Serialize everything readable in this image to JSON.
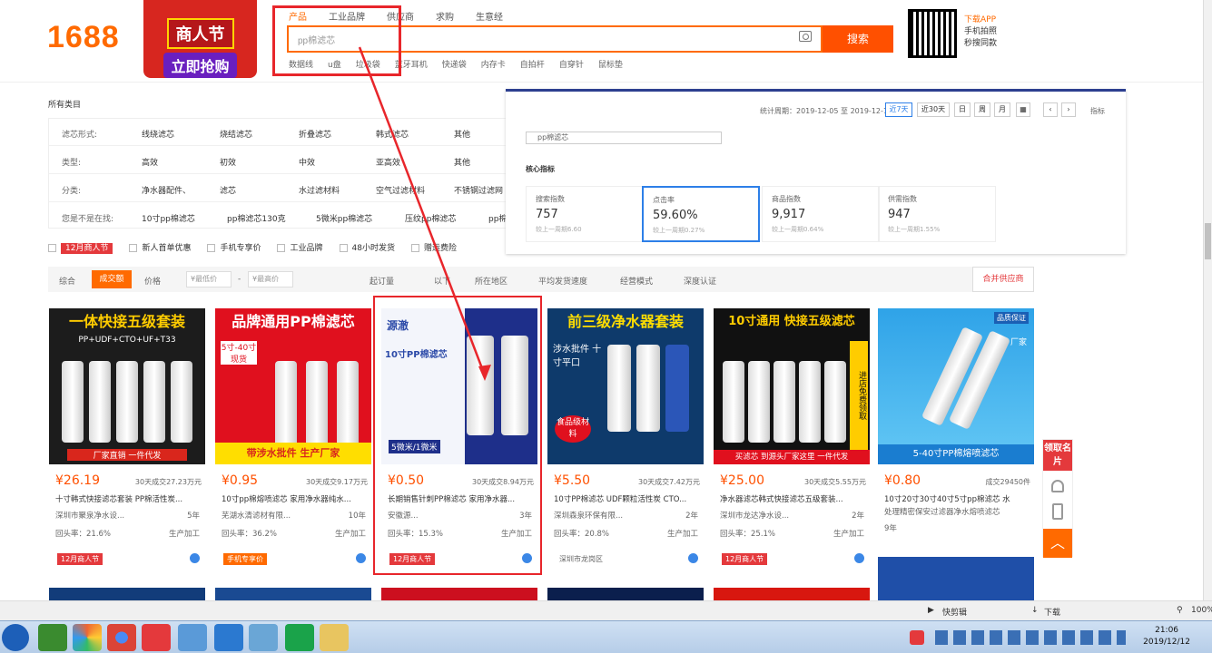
{
  "header": {
    "logo": "1688",
    "promo_line1": "商人节",
    "promo_line2": "立即抢购",
    "search_tabs": [
      "产品",
      "工业品牌",
      "供应商",
      "求购",
      "生意经"
    ],
    "search_value": "pp棉滤芯",
    "search_button": "搜索",
    "hot_words": [
      "数据线",
      "u盘",
      "垃圾袋",
      "蓝牙耳机",
      "快递袋",
      "内存卡",
      "自拍杆",
      "自穿针",
      "鼠标垫"
    ],
    "app_line1": "下载APP",
    "app_line2": "手机拍照",
    "app_line3": "秒搜同款"
  },
  "category": {
    "title": "所有类目",
    "rows": [
      {
        "label": "滤芯形式:",
        "items": [
          "线绕滤芯",
          "烧结滤芯",
          "折叠滤芯",
          "韩式滤芯",
          "其他"
        ]
      },
      {
        "label": "类型:",
        "items": [
          "高效",
          "初效",
          "中效",
          "亚高效",
          "其他"
        ]
      },
      {
        "label": "分类:",
        "items": [
          "净水器配件、",
          "滤芯",
          "水过滤材料",
          "空气过滤材料",
          "不锈钢过滤网"
        ]
      },
      {
        "label": "您是不是在找:",
        "items": [
          "10寸pp棉滤芯",
          "pp棉滤芯130克",
          "5微米pp棉滤芯",
          "压纹pp棉滤芯",
          "pp棉"
        ]
      }
    ]
  },
  "checks": {
    "badge": "12月商人节",
    "items": [
      "新人首单优惠",
      "手机专享价",
      "工业品牌",
      "48小时发货",
      "赠运费险"
    ]
  },
  "sortbar": {
    "items": [
      "综合",
      "成交额",
      "价格",
      "¥最低价",
      "¥最高价",
      "起订量",
      "以下",
      "所在地区",
      "平均发货速度",
      "经营模式",
      "深度认证"
    ],
    "dash": "-",
    "supplier": "合并供应商"
  },
  "stats_popup": {
    "period": "统计周期：2019-12-05 至 2019-12-11",
    "ranges": [
      "近7天",
      "近30天",
      "日",
      "周",
      "月"
    ],
    "more": "指标",
    "keyword": "pp棉滤芯",
    "core_title": "核心指标",
    "metrics": [
      {
        "label": "搜索指数",
        "value": "757",
        "sub": "较上一周期6.60"
      },
      {
        "label": "点击率",
        "value": "59.60%",
        "sub": "较上一周期0.27%"
      },
      {
        "label": "商品指数",
        "value": "9,917",
        "sub": "较上一周期0.64%"
      },
      {
        "label": "供需指数",
        "value": "947",
        "sub": "较上一周期1.55%"
      }
    ]
  },
  "products": [
    {
      "img_title": "一体快接五级套装",
      "sub": "PP+UDF+CTO+UF+T33",
      "bottom": "厂家直销 一件代发",
      "price": "¥26.19",
      "sold": "30天成交27.23万元",
      "title": "十寸韩式快接滤芯套装 PP棉活性炭...",
      "company": "深圳市聚泉净水设...",
      "years": "5年",
      "rebuy": "回头率：21.6%",
      "mode": "生产加工",
      "tag": "12月商人节"
    },
    {
      "img_title": "品牌通用PP棉滤芯",
      "sub": "5寸-40寸现货",
      "bottom": "带涉水批件 生产厂家",
      "price": "¥0.95",
      "sold": "30天成交9.17万元",
      "title": "10寸pp棉熔喷滤芯 家用净水器纯水...",
      "company": "芜湖水清滤材有限...",
      "years": "10年",
      "rebuy": "回头率：36.2%",
      "mode": "生产加工",
      "tag": "手机专享价"
    },
    {
      "img_title": "源澈",
      "sub": "10寸PP棉滤芯",
      "bottom": "5微米/1微米",
      "price": "¥0.50",
      "sold": "30天成交8.94万元",
      "title": "长期销售针刺PP棉滤芯 家用净水器...",
      "company": "安徽源...",
      "years": "3年",
      "rebuy": "回头率：15.3%",
      "mode": "生产加工",
      "tag": "12月商人节"
    },
    {
      "img_title": "前三级净水器套装",
      "sub": "涉水批件 十寸平口",
      "bottom": "食品级材料",
      "price": "¥5.50",
      "sold": "30天成交7.42万元",
      "title": "10寸PP棉滤芯 UDF颗粒活性炭 CTO...",
      "company": "深圳森泉环保有限...",
      "years": "2年",
      "rebuy": "回头率：20.8%",
      "mode": "生产加工",
      "tag": "深圳市龙岗区"
    },
    {
      "img_title": "10寸通用 快接五级滤芯",
      "sub": "进店免费领取",
      "bottom": "买滤芯 到源头厂家这里 一件代发",
      "price": "¥25.00",
      "sold": "30天成交5.55万元",
      "title": "净水器滤芯韩式快接滤芯五级套装...",
      "company": "深圳市龙达净水设...",
      "years": "2年",
      "rebuy": "回头率：25.1%",
      "mode": "生产加工",
      "tag": "12月商人节"
    },
    {
      "img_title": "品质保证",
      "sub": "厂家",
      "bottom": "5-40寸PP棉熔喷滤芯",
      "price": "¥0.80",
      "sold": "成交29450件",
      "title": "10寸20寸30寸40寸5寸pp棉滤芯 水",
      "company": "处理精密保安过滤器净水熔喷滤芯",
      "years": "9年",
      "rebuy": "",
      "mode": "",
      "tag": ""
    }
  ],
  "sidebar": {
    "card_label": "领取名片",
    "up": "︿"
  },
  "statusbar": {
    "items": [
      "快剪辑",
      "下载",
      "100%"
    ]
  },
  "taskbar": {
    "time": "21:06",
    "date": "2019/12/12"
  },
  "colors": {
    "accent": "#ff6a00",
    "red": "#e4393c",
    "highlight": "#e8262b",
    "blue": "#2d7fe8"
  }
}
